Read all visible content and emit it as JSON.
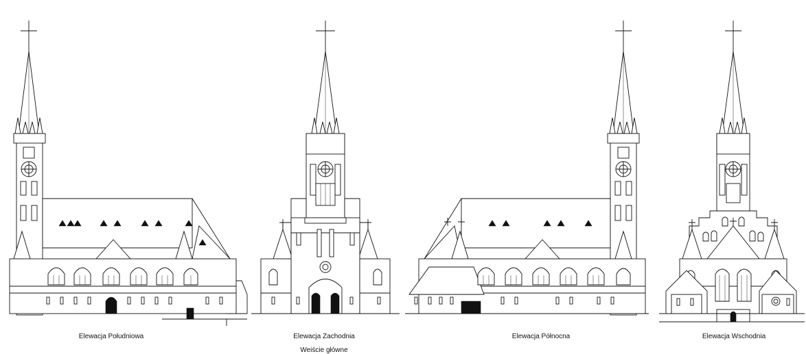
{
  "elevations": [
    {
      "caption": "Elewacja Południowa",
      "kind": "side"
    },
    {
      "caption": "Elewacja Zachodnia",
      "subcaption": "Weiście główne",
      "kind": "front"
    },
    {
      "caption": "Elewacja Północna",
      "kind": "side-mirror"
    },
    {
      "caption": "Elewacja Wschodnia",
      "kind": "apse"
    }
  ]
}
